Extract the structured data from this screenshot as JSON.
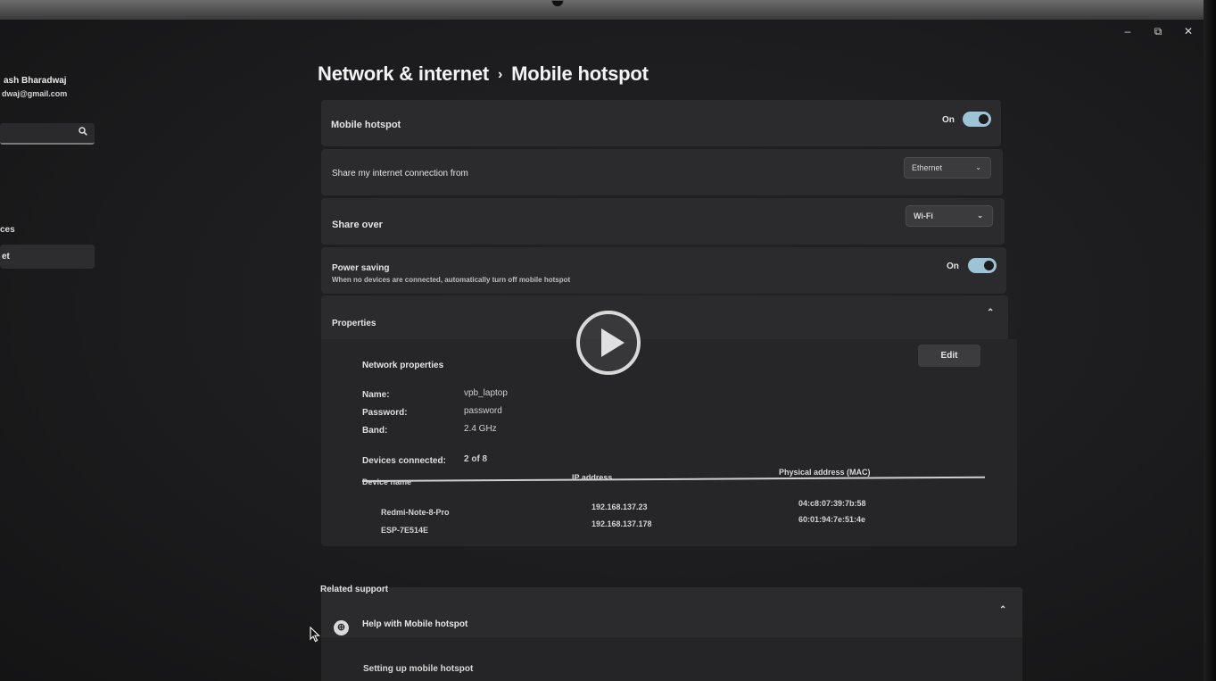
{
  "window": {
    "minimize": "–",
    "restore": "⧉",
    "close": "✕"
  },
  "sidebar": {
    "user_name": "ash Bharadwaj",
    "user_email": "dwaj@gmail.com",
    "search_icon": "search-icon",
    "nav_devices": "ces",
    "nav_network": "et"
  },
  "breadcrumb": {
    "parent": "Network & internet",
    "separator": "›",
    "current": "Mobile hotspot"
  },
  "mobile_hotspot": {
    "label": "Mobile hotspot",
    "state": "On",
    "enabled": true
  },
  "share_from": {
    "label": "Share my internet connection from",
    "value": "Ethernet",
    "chevron": "⌄"
  },
  "share_over": {
    "label": "Share over",
    "value": "Wi-Fi",
    "chevron": "⌄"
  },
  "power_saving": {
    "label": "Power saving",
    "description": "When no devices are connected, automatically turn off mobile hotspot",
    "state": "On",
    "enabled": true
  },
  "properties": {
    "label": "Properties",
    "collapse_chevron": "⌃",
    "network_properties_title": "Network properties",
    "edit_label": "Edit",
    "name_key": "Name:",
    "name_value": "vpb_laptop",
    "password_key": "Password:",
    "password_value": "password",
    "band_key": "Band:",
    "band_value": "2.4 GHz",
    "devices_connected_key": "Devices connected:",
    "devices_connected_value": "2 of 8",
    "columns": [
      "Device name",
      "IP address",
      "Physical address (MAC)"
    ],
    "devices": [
      {
        "name": "Redmi-Note-8-Pro",
        "ip": "192.168.137.23",
        "mac": "04:c8:07:39:7b:58"
      },
      {
        "name": "ESP-7E514E",
        "ip": "192.168.137.178",
        "mac": "60:01:94:7e:51:4e"
      }
    ]
  },
  "related_support": {
    "title": "Related support",
    "help_label": "Help with Mobile hotspot",
    "help_chevron": "⌃",
    "link": "Setting up mobile hotspot"
  },
  "colors": {
    "toggle_on": "#9cc4d6",
    "card_bg": "#2b2b2d",
    "page_bg": "#1c1c1e"
  }
}
